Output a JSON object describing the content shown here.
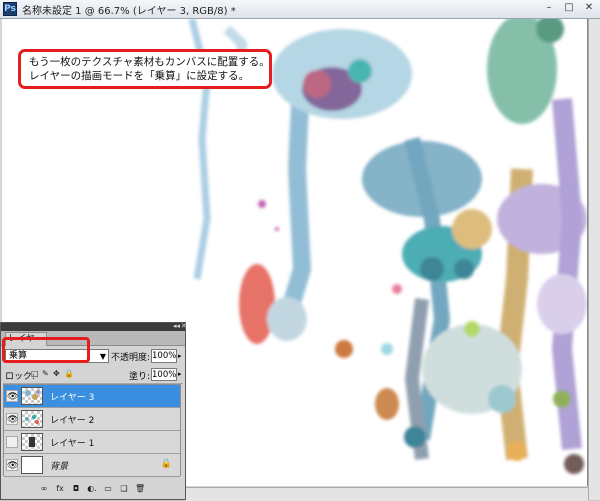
{
  "window": {
    "app_icon": "Ps",
    "title": "名称未設定 1 @ 66.7% (レイヤー 3, RGB/8) *",
    "controls": {
      "minimize": "–",
      "maximize": "□",
      "close": "✕"
    }
  },
  "callout": {
    "line1": "もう一枚のテクスチャ素材もカンバスに配置する。",
    "line2": "レイヤーの描画モードを「乗算」に設定する。"
  },
  "layers_panel": {
    "collapse_glyph": "◂◂",
    "close_glyph": "✕",
    "tab_label": "レイヤー",
    "blend_mode": "乗算",
    "opacity_label": "不透明度:",
    "opacity_value": "100%",
    "lock_label": "ロック:",
    "lock_icons": [
      "□",
      "✎",
      "✥",
      "🔒"
    ],
    "fill_label": "塗り:",
    "fill_value": "100%",
    "layers": [
      {
        "name": "レイヤー 3",
        "selected": true,
        "visible": true
      },
      {
        "name": "レイヤー 2",
        "selected": false,
        "visible": true
      },
      {
        "name": "レイヤー 1",
        "selected": false,
        "visible": false
      },
      {
        "name": "背景",
        "selected": false,
        "visible": true,
        "locked": true
      }
    ],
    "footer_icons": [
      "∞",
      "fx",
      "◘",
      "◐.",
      "▭",
      "❑",
      "🗑"
    ]
  },
  "colors": {
    "accent_red": "#e51d1d",
    "selection_blue": "#3a8fe0"
  }
}
